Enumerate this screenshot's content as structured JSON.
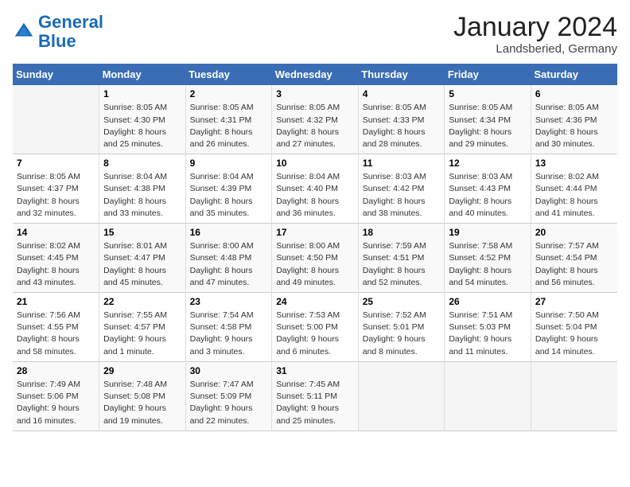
{
  "logo": {
    "line1": "General",
    "line2": "Blue"
  },
  "title": "January 2024",
  "location": "Landsberied, Germany",
  "weekdays": [
    "Sunday",
    "Monday",
    "Tuesday",
    "Wednesday",
    "Thursday",
    "Friday",
    "Saturday"
  ],
  "weeks": [
    [
      {
        "num": "",
        "info": ""
      },
      {
        "num": "1",
        "info": "Sunrise: 8:05 AM\nSunset: 4:30 PM\nDaylight: 8 hours\nand 25 minutes."
      },
      {
        "num": "2",
        "info": "Sunrise: 8:05 AM\nSunset: 4:31 PM\nDaylight: 8 hours\nand 26 minutes."
      },
      {
        "num": "3",
        "info": "Sunrise: 8:05 AM\nSunset: 4:32 PM\nDaylight: 8 hours\nand 27 minutes."
      },
      {
        "num": "4",
        "info": "Sunrise: 8:05 AM\nSunset: 4:33 PM\nDaylight: 8 hours\nand 28 minutes."
      },
      {
        "num": "5",
        "info": "Sunrise: 8:05 AM\nSunset: 4:34 PM\nDaylight: 8 hours\nand 29 minutes."
      },
      {
        "num": "6",
        "info": "Sunrise: 8:05 AM\nSunset: 4:36 PM\nDaylight: 8 hours\nand 30 minutes."
      }
    ],
    [
      {
        "num": "7",
        "info": "Sunrise: 8:05 AM\nSunset: 4:37 PM\nDaylight: 8 hours\nand 32 minutes."
      },
      {
        "num": "8",
        "info": "Sunrise: 8:04 AM\nSunset: 4:38 PM\nDaylight: 8 hours\nand 33 minutes."
      },
      {
        "num": "9",
        "info": "Sunrise: 8:04 AM\nSunset: 4:39 PM\nDaylight: 8 hours\nand 35 minutes."
      },
      {
        "num": "10",
        "info": "Sunrise: 8:04 AM\nSunset: 4:40 PM\nDaylight: 8 hours\nand 36 minutes."
      },
      {
        "num": "11",
        "info": "Sunrise: 8:03 AM\nSunset: 4:42 PM\nDaylight: 8 hours\nand 38 minutes."
      },
      {
        "num": "12",
        "info": "Sunrise: 8:03 AM\nSunset: 4:43 PM\nDaylight: 8 hours\nand 40 minutes."
      },
      {
        "num": "13",
        "info": "Sunrise: 8:02 AM\nSunset: 4:44 PM\nDaylight: 8 hours\nand 41 minutes."
      }
    ],
    [
      {
        "num": "14",
        "info": "Sunrise: 8:02 AM\nSunset: 4:45 PM\nDaylight: 8 hours\nand 43 minutes."
      },
      {
        "num": "15",
        "info": "Sunrise: 8:01 AM\nSunset: 4:47 PM\nDaylight: 8 hours\nand 45 minutes."
      },
      {
        "num": "16",
        "info": "Sunrise: 8:00 AM\nSunset: 4:48 PM\nDaylight: 8 hours\nand 47 minutes."
      },
      {
        "num": "17",
        "info": "Sunrise: 8:00 AM\nSunset: 4:50 PM\nDaylight: 8 hours\nand 49 minutes."
      },
      {
        "num": "18",
        "info": "Sunrise: 7:59 AM\nSunset: 4:51 PM\nDaylight: 8 hours\nand 52 minutes."
      },
      {
        "num": "19",
        "info": "Sunrise: 7:58 AM\nSunset: 4:52 PM\nDaylight: 8 hours\nand 54 minutes."
      },
      {
        "num": "20",
        "info": "Sunrise: 7:57 AM\nSunset: 4:54 PM\nDaylight: 8 hours\nand 56 minutes."
      }
    ],
    [
      {
        "num": "21",
        "info": "Sunrise: 7:56 AM\nSunset: 4:55 PM\nDaylight: 8 hours\nand 58 minutes."
      },
      {
        "num": "22",
        "info": "Sunrise: 7:55 AM\nSunset: 4:57 PM\nDaylight: 9 hours\nand 1 minute."
      },
      {
        "num": "23",
        "info": "Sunrise: 7:54 AM\nSunset: 4:58 PM\nDaylight: 9 hours\nand 3 minutes."
      },
      {
        "num": "24",
        "info": "Sunrise: 7:53 AM\nSunset: 5:00 PM\nDaylight: 9 hours\nand 6 minutes."
      },
      {
        "num": "25",
        "info": "Sunrise: 7:52 AM\nSunset: 5:01 PM\nDaylight: 9 hours\nand 8 minutes."
      },
      {
        "num": "26",
        "info": "Sunrise: 7:51 AM\nSunset: 5:03 PM\nDaylight: 9 hours\nand 11 minutes."
      },
      {
        "num": "27",
        "info": "Sunrise: 7:50 AM\nSunset: 5:04 PM\nDaylight: 9 hours\nand 14 minutes."
      }
    ],
    [
      {
        "num": "28",
        "info": "Sunrise: 7:49 AM\nSunset: 5:06 PM\nDaylight: 9 hours\nand 16 minutes."
      },
      {
        "num": "29",
        "info": "Sunrise: 7:48 AM\nSunset: 5:08 PM\nDaylight: 9 hours\nand 19 minutes."
      },
      {
        "num": "30",
        "info": "Sunrise: 7:47 AM\nSunset: 5:09 PM\nDaylight: 9 hours\nand 22 minutes."
      },
      {
        "num": "31",
        "info": "Sunrise: 7:45 AM\nSunset: 5:11 PM\nDaylight: 9 hours\nand 25 minutes."
      },
      {
        "num": "",
        "info": ""
      },
      {
        "num": "",
        "info": ""
      },
      {
        "num": "",
        "info": ""
      }
    ]
  ]
}
